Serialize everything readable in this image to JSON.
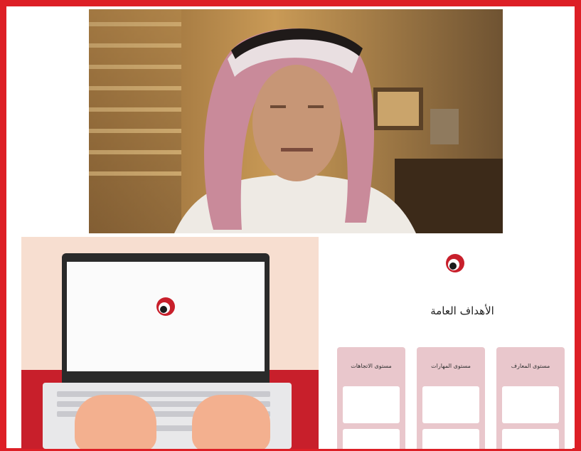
{
  "slide": {
    "title": "الأهداف العامة",
    "logo_caption": "",
    "columns": [
      {
        "header": "مستوى المعارف",
        "items": [
          "",
          ""
        ]
      },
      {
        "header": "مستوى المهارات",
        "items": [
          "",
          ""
        ]
      },
      {
        "header": "مستوى الاتجاهات",
        "items": [
          "",
          ""
        ]
      }
    ]
  },
  "colors": {
    "frame_border": "#dd1f26",
    "slide_left_bg": "#f7ded0",
    "red_band": "#c81f2b",
    "column_bg": "#e9c7cc"
  },
  "icons": [
    "presenter-video",
    "organization-logo",
    "laptop-illustration"
  ]
}
